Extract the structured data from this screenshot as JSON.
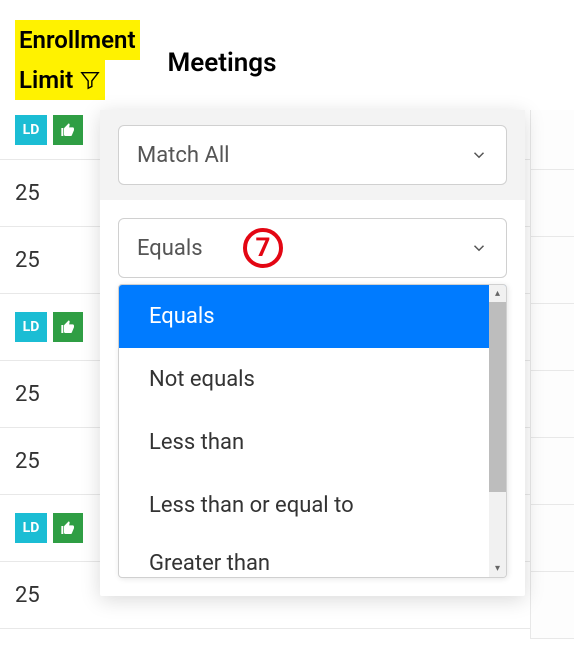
{
  "header": {
    "enrollment_line1": "Enrollment",
    "enrollment_line2": "Limit",
    "meetings": "Meetings"
  },
  "badges": {
    "ld_label": "LD"
  },
  "rows": [
    {
      "type": "badges"
    },
    {
      "type": "value",
      "value": "25"
    },
    {
      "type": "value",
      "value": "25"
    },
    {
      "type": "badges"
    },
    {
      "type": "value",
      "value": "25"
    },
    {
      "type": "value",
      "value": "25"
    },
    {
      "type": "badges"
    },
    {
      "type": "value",
      "value": "25"
    }
  ],
  "filter_panel": {
    "match_mode": "Match All",
    "operator_selected": "Equals",
    "options": [
      {
        "label": "Equals",
        "selected": true
      },
      {
        "label": "Not equals",
        "selected": false
      },
      {
        "label": "Less than",
        "selected": false
      },
      {
        "label": "Less than or equal to",
        "selected": false
      },
      {
        "label": "Greater than",
        "selected": false
      }
    ]
  },
  "annotation": {
    "step": "7"
  }
}
